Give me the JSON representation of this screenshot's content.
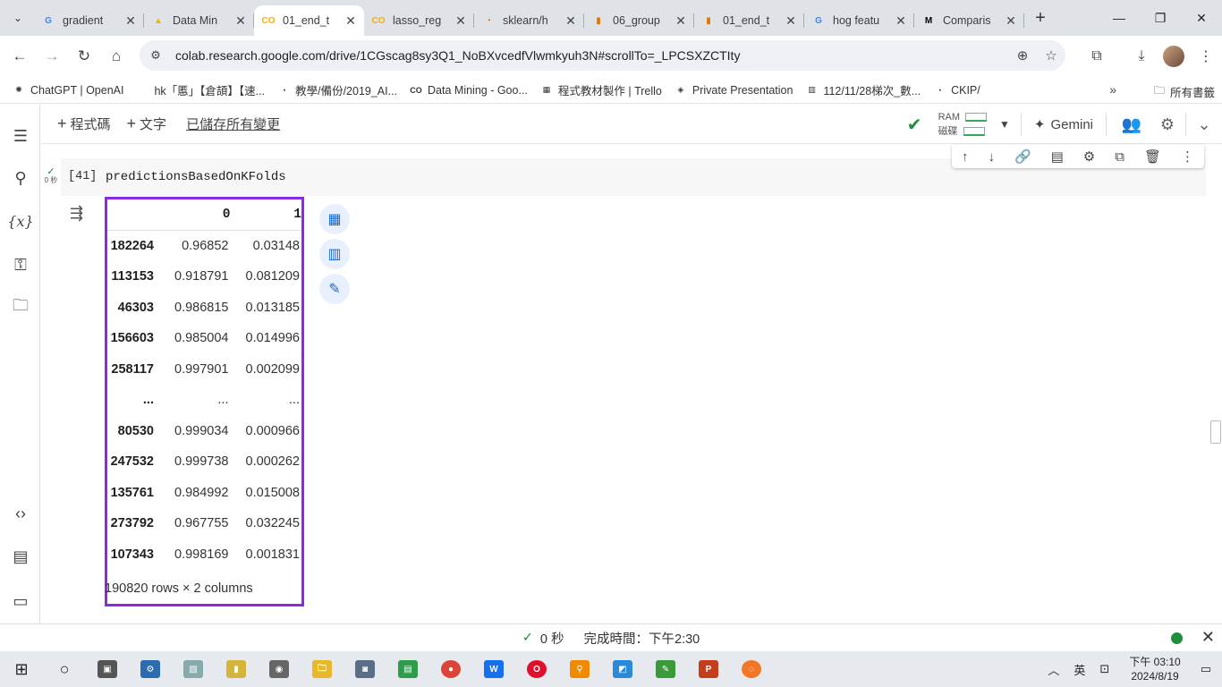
{
  "browser": {
    "tabs": [
      {
        "title": "gradient",
        "favicon": "G",
        "fav_color": "#4285f4",
        "active": false
      },
      {
        "title": "Data Min",
        "favicon": "▲",
        "fav_color": "#f4b400",
        "active": false
      },
      {
        "title": "01_end_t",
        "favicon": "CO",
        "fav_color": "#f9ab00",
        "active": true
      },
      {
        "title": "lasso_reg",
        "favicon": "CO",
        "fav_color": "#f9ab00",
        "active": false
      },
      {
        "title": "sklearn/h",
        "favicon": "◔",
        "fav_color": "#e8710a",
        "active": false
      },
      {
        "title": "06_group",
        "favicon": "▮",
        "fav_color": "#e37400",
        "active": false
      },
      {
        "title": "01_end_t",
        "favicon": "▮",
        "fav_color": "#e37400",
        "active": false
      },
      {
        "title": "hog featu",
        "favicon": "G",
        "fav_color": "#4285f4",
        "active": false
      },
      {
        "title": "Comparis",
        "favicon": "M",
        "fav_color": "#000000",
        "active": false
      }
    ],
    "url": "colab.research.google.com/drive/1CGscag8sy3Q1_NoBXvcedfVlwmkyuh3N#scrollTo=_LPCSXZCTIty",
    "bookmarks": [
      {
        "label": "ChatGPT | OpenAI",
        "icon": "✺"
      },
      {
        "label": "hk「慝」【倉頡】【速...",
        "icon": ""
      },
      {
        "label": "教學/備份/2019_AI...",
        "icon": "◔"
      },
      {
        "label": "Data Mining - Goo...",
        "icon": "CO"
      },
      {
        "label": "程式教材製作 | Trello",
        "icon": "▦"
      },
      {
        "label": "Private Presentation",
        "icon": "◈"
      },
      {
        "label": "112/11/28梯次_數...",
        "icon": "▥"
      },
      {
        "label": "CKIP/",
        "icon": "◔"
      }
    ],
    "all_bookmarks": "所有書籤"
  },
  "colab": {
    "add_code": "程式碼",
    "add_text": "文字",
    "saved_status": "已儲存所有變更",
    "ram_label": "RAM",
    "disk_label": "磁碟",
    "gemini_label": "Gemini"
  },
  "cell": {
    "exec_count": "[41]",
    "exec_time": "0 秒",
    "code": "predictionsBasedOnKFolds"
  },
  "dataframe": {
    "columns": [
      "",
      "0",
      "1"
    ],
    "rows": [
      {
        "index": "182264",
        "c0": "0.96852",
        "c1": "0.03148"
      },
      {
        "index": "113153",
        "c0": "0.918791",
        "c1": "0.081209"
      },
      {
        "index": "46303",
        "c0": "0.986815",
        "c1": "0.013185"
      },
      {
        "index": "156603",
        "c0": "0.985004",
        "c1": "0.014996"
      },
      {
        "index": "258117",
        "c0": "0.997901",
        "c1": "0.002099"
      },
      {
        "index": "...",
        "c0": "...",
        "c1": "..."
      },
      {
        "index": "80530",
        "c0": "0.999034",
        "c1": "0.000966"
      },
      {
        "index": "247532",
        "c0": "0.999738",
        "c1": "0.000262"
      },
      {
        "index": "135761",
        "c0": "0.984992",
        "c1": "0.015008"
      },
      {
        "index": "273792",
        "c0": "0.967755",
        "c1": "0.032245"
      },
      {
        "index": "107343",
        "c0": "0.998169",
        "c1": "0.001831"
      }
    ],
    "footer": "190820 rows × 2 columns"
  },
  "statusbar": {
    "elapsed": "0 秒",
    "completed": "完成時間：下午2:30"
  },
  "taskbar": {
    "ime": "英",
    "time": "下午 03:10",
    "date": "2024/8/19"
  }
}
